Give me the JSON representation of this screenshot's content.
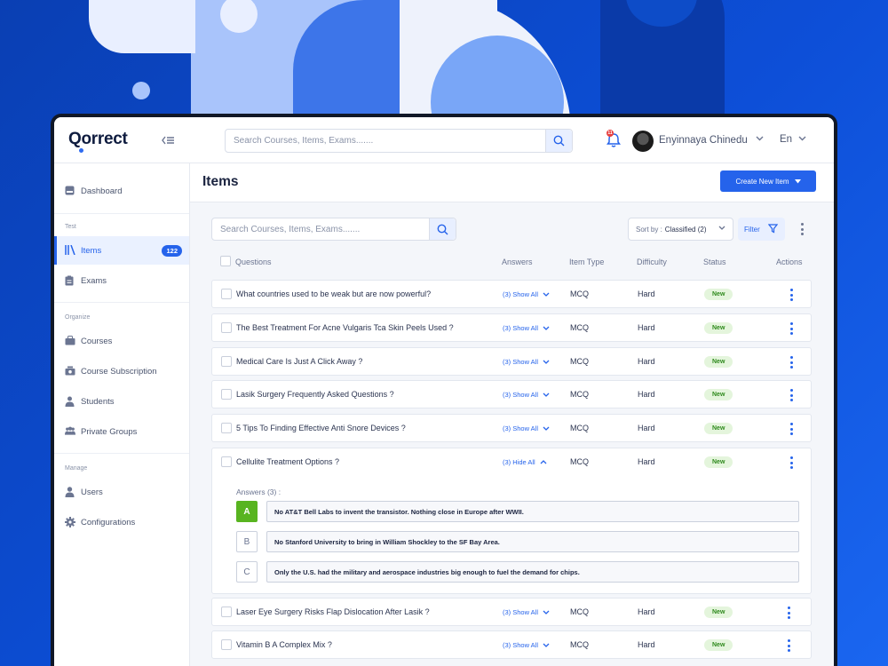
{
  "app": {
    "logo": "Qorrect"
  },
  "topbar": {
    "search_placeholder": "Search Courses, Items, Exams.......",
    "notification_count": "11",
    "user_name": "Enyinnaya Chinedu",
    "language": "En"
  },
  "sidebar": {
    "dashboard": "Dashboard",
    "section_test": "Test",
    "items": "Items",
    "items_count": "122",
    "exams": "Exams",
    "section_organize": "Organize",
    "courses": "Courses",
    "course_subscription": "Course Subscription",
    "students": "Students",
    "private_groups": "Private Groups",
    "section_manage": "Manage",
    "users": "Users",
    "configurations": "Configurations"
  },
  "main": {
    "title": "Items",
    "create_button": "Create New Item",
    "list_search_placeholder": "Search Courses, Items, Exams.......",
    "sort_label": "Sort by :",
    "sort_value": "Classified (2)",
    "filter_label": "Filter"
  },
  "table": {
    "headers": {
      "questions": "Questions",
      "answers": "Answers",
      "item_type": "Item Type",
      "difficulty": "Difficulty",
      "status": "Status",
      "actions": "Actions"
    },
    "rows": [
      {
        "question": "What countries used to be weak but are now powerful?",
        "answers": "(3) Show All",
        "type": "MCQ",
        "difficulty": "Hard",
        "status": "New"
      },
      {
        "question": "The Best Treatment For Acne Vulgaris Tca Skin Peels Used ?",
        "answers": "(3) Show All",
        "type": "MCQ",
        "difficulty": "Hard",
        "status": "New"
      },
      {
        "question": "Medical Care Is Just A Click Away ?",
        "answers": "(3) Show All",
        "type": "MCQ",
        "difficulty": "Hard",
        "status": "New"
      },
      {
        "question": "Lasik Surgery Frequently Asked Questions ?",
        "answers": "(3) Show All",
        "type": "MCQ",
        "difficulty": "Hard",
        "status": "New"
      },
      {
        "question": "5 Tips To Finding Effective Anti Snore Devices ?",
        "answers": "(3) Show All",
        "type": "MCQ",
        "difficulty": "Hard",
        "status": "New"
      },
      {
        "question": "Cellulite Treatment Options ?",
        "answers": "(3) Hide All",
        "type": "MCQ",
        "difficulty": "Hard",
        "status": "New"
      },
      {
        "question": "Laser Eye Surgery Risks Flap Dislocation After Lasik ?",
        "answers": "(3) Show All",
        "type": "MCQ",
        "difficulty": "Hard",
        "status": "New"
      },
      {
        "question": "Vitamin B A Complex Mix ?",
        "answers": "(3) Show All",
        "type": "MCQ",
        "difficulty": "Hard",
        "status": "New"
      }
    ],
    "expanded": {
      "label": "Answers (3) :",
      "options": [
        {
          "letter": "A",
          "text": "No AT&T Bell Labs to invent the transistor. Nothing close in Europe after WWII.",
          "correct": true
        },
        {
          "letter": "B",
          "text": "No Stanford University to bring in William Shockley to the SF Bay Area.",
          "correct": false
        },
        {
          "letter": "C",
          "text": "Only the U.S. had the military and aerospace industries big enough to fuel the demand for chips.",
          "correct": false
        }
      ]
    }
  },
  "colors": {
    "accent": "#2563eb",
    "correct": "#58b420",
    "status_bg": "#e4f5dc"
  }
}
